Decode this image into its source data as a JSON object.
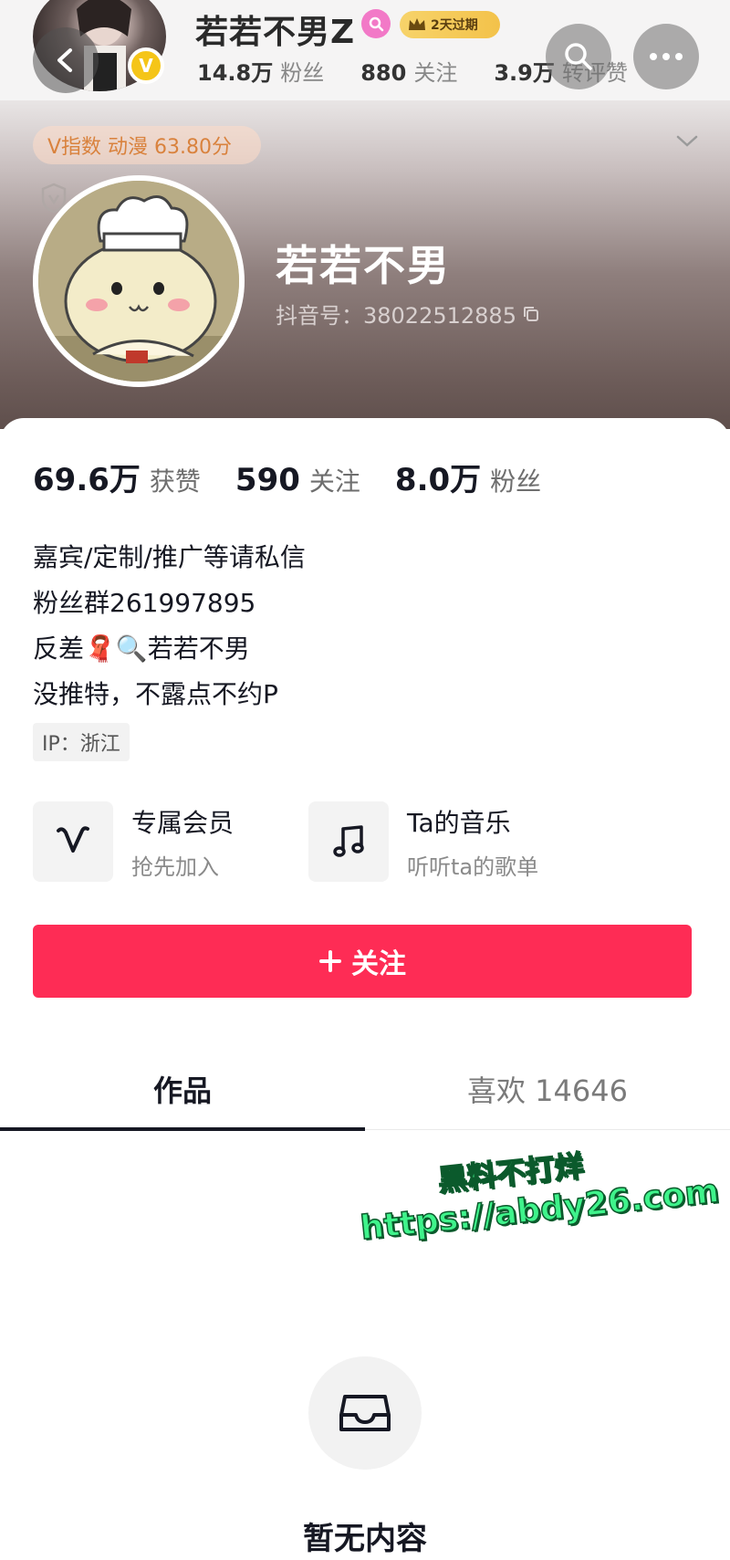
{
  "header": {
    "top_name": "若若不男Z",
    "vip_label": "2天过期",
    "top_stats": [
      {
        "value": "14.8万",
        "label": "粉丝"
      },
      {
        "value": "880",
        "label": "关注"
      },
      {
        "value": "3.9万",
        "label": "转评赞"
      }
    ],
    "v_index": "V指数 动漫 63.80分",
    "verify_mark": "V"
  },
  "profile": {
    "nickname": "若若不男",
    "douyin_id": "抖音号：38022512885"
  },
  "stats": [
    {
      "value": "69.6万",
      "label": "获赞"
    },
    {
      "value": "590",
      "label": "关注"
    },
    {
      "value": "8.0万",
      "label": "粉丝"
    }
  ],
  "bio": [
    "嘉宾/定制/推广等请私信",
    "粉丝群261997895",
    "反差🧣🔍若若不男",
    "没推特，不露点不约P"
  ],
  "ip": "IP：浙江",
  "features": [
    {
      "title": "专属会员",
      "subtitle": "抢先加入",
      "icon": "v-member-icon"
    },
    {
      "title": "Ta的音乐",
      "subtitle": "听听ta的歌单",
      "icon": "music-note-icon"
    }
  ],
  "follow_button": {
    "label": "关注",
    "icon": "plus-icon"
  },
  "tabs": [
    {
      "label": "作品",
      "active": true
    },
    {
      "label": "喜欢 14646",
      "active": false
    }
  ],
  "watermark": {
    "line1": "黑料不打烊",
    "line2": "https://abdy26.com"
  },
  "empty_state": {
    "text": "暂无内容",
    "icon": "inbox-tray-icon"
  },
  "colors": {
    "accent": "#fe2c55",
    "vindex_text": "#d9823d",
    "watermark": "#3ff38b"
  }
}
